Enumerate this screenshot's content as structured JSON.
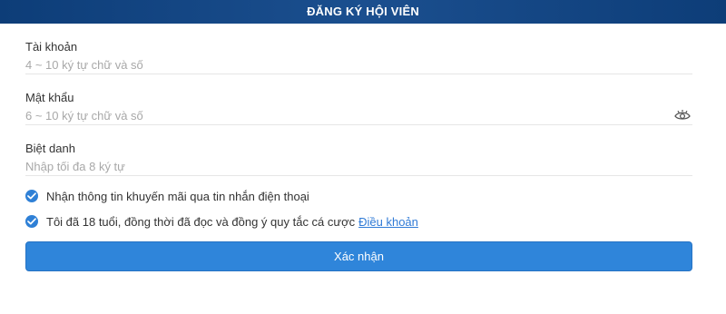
{
  "header": {
    "title": "ĐĂNG KÝ HỘI VIÊN",
    "color": "#0d3d78"
  },
  "form": {
    "fields": [
      {
        "label": "Tài khoản",
        "placeholder": "4 ~ 10 ký tự chữ và số",
        "value": ""
      },
      {
        "label": "Mật khẩu",
        "placeholder": "6 ~ 10 ký tự chữ và số",
        "value": "",
        "icon": "eye-icon"
      },
      {
        "label": "Biệt danh",
        "placeholder": "Nhập tối đa 8 ký tự",
        "value": ""
      }
    ],
    "checkboxes": [
      {
        "text": "Nhận thông tin khuyến mãi qua tin nhắn điện thoại",
        "checked": true
      },
      {
        "text": "Tôi đã 18 tuổi, đồng thời đã đọc và đồng ý quy tắc cá cược",
        "link": "Điều khoản",
        "checked": true
      }
    ],
    "submit_label": "Xác nhận"
  },
  "colors": {
    "accent": "#2f85da",
    "link": "#2f7ad6"
  }
}
